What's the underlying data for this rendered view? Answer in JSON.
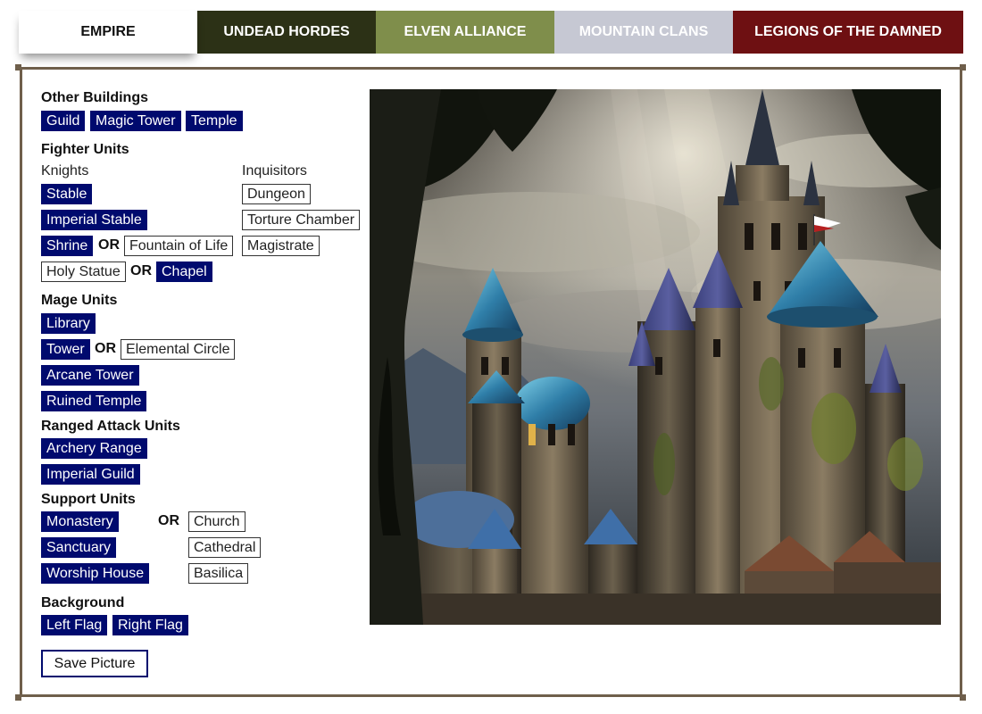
{
  "tabs": [
    {
      "label": "EMPIRE",
      "active": true
    },
    {
      "label": "UNDEAD HORDES",
      "active": false
    },
    {
      "label": "ELVEN ALLIANCE",
      "active": false
    },
    {
      "label": "MOUNTAIN CLANS",
      "active": false
    },
    {
      "label": "LEGIONS OF THE DAMNED",
      "active": false
    }
  ],
  "sections": {
    "other_buildings": {
      "title": "Other Buildings",
      "items": [
        {
          "label": "Guild",
          "selected": true
        },
        {
          "label": "Magic Tower",
          "selected": true
        },
        {
          "label": "Temple",
          "selected": true
        }
      ]
    },
    "fighter_units": {
      "title": "Fighter Units",
      "knights": {
        "title": "Knights",
        "stable": {
          "label": "Stable",
          "selected": true
        },
        "imperial_stable": {
          "label": "Imperial Stable",
          "selected": true
        },
        "shrine": {
          "label": "Shrine",
          "selected": true
        },
        "fountain": {
          "label": "Fountain of Life",
          "selected": false
        },
        "holy_statue": {
          "label": "Holy Statue",
          "selected": false
        },
        "chapel": {
          "label": "Chapel",
          "selected": true
        }
      },
      "inquisitors": {
        "title": "Inquisitors",
        "dungeon": {
          "label": "Dungeon",
          "selected": false
        },
        "torture_chamber": {
          "label": "Torture Chamber",
          "selected": false
        },
        "magistrate": {
          "label": "Magistrate",
          "selected": false
        }
      }
    },
    "mage_units": {
      "title": "Mage Units",
      "library": {
        "label": "Library",
        "selected": true
      },
      "tower": {
        "label": "Tower",
        "selected": true
      },
      "elemental_circle": {
        "label": "Elemental Circle",
        "selected": false
      },
      "arcane_tower": {
        "label": "Arcane Tower",
        "selected": true
      },
      "ruined_temple": {
        "label": "Ruined Temple",
        "selected": true
      }
    },
    "ranged_units": {
      "title": "Ranged Attack Units",
      "archery_range": {
        "label": "Archery Range",
        "selected": true
      },
      "imperial_guild": {
        "label": "Imperial Guild",
        "selected": true
      }
    },
    "support_units": {
      "title": "Support Units",
      "monastery": {
        "label": "Monastery",
        "selected": true
      },
      "church": {
        "label": "Church",
        "selected": false
      },
      "sanctuary": {
        "label": "Sanctuary",
        "selected": true
      },
      "cathedral": {
        "label": "Cathedral",
        "selected": false
      },
      "worship_house": {
        "label": "Worship House",
        "selected": true
      },
      "basilica": {
        "label": "Basilica",
        "selected": false
      }
    },
    "background": {
      "title": "Background",
      "left_flag": {
        "label": "Left Flag",
        "selected": true
      },
      "right_flag": {
        "label": "Right Flag",
        "selected": true
      }
    }
  },
  "or_label": "OR",
  "save_label": "Save Picture",
  "colors": {
    "selected_bg": "#000a6e",
    "frame": "#6f5f4b",
    "tab_undead": "#2c3116",
    "tab_elven": "#7f8e4b",
    "tab_mountain": "#c6c8d3",
    "tab_legions": "#6e1012"
  }
}
